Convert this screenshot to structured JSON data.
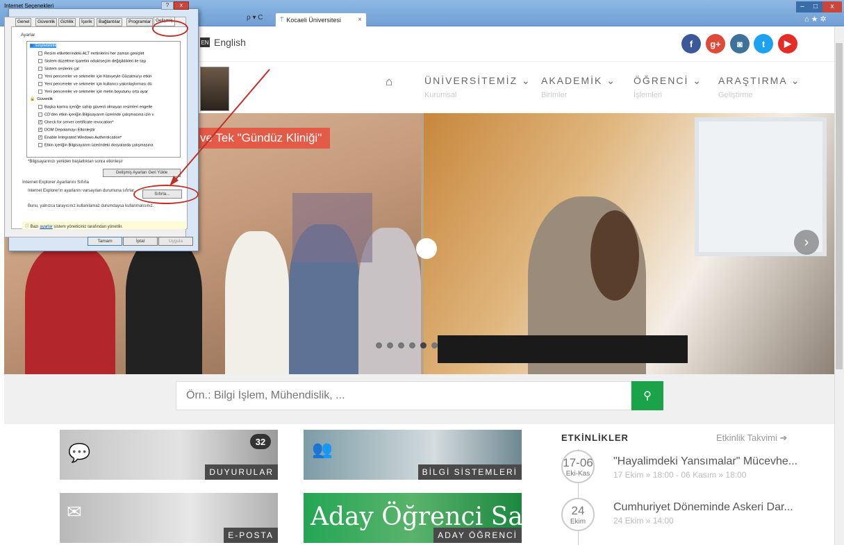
{
  "browser": {
    "tab_title": "Kocaeli Üniversitesi",
    "tab_icon": "kou-favicon-icon",
    "addr_controls": "ρ ▾ C",
    "icons": [
      "home-icon",
      "star-icon",
      "gear-icon"
    ],
    "window_buttons": {
      "min": "–",
      "max": "□",
      "close": "x"
    }
  },
  "site": {
    "language": "English",
    "social": [
      {
        "name": "facebook-icon",
        "glyph": "f",
        "color": "#3b5998"
      },
      {
        "name": "google-plus-icon",
        "glyph": "g+",
        "color": "#dd4b39"
      },
      {
        "name": "instagram-icon",
        "glyph": "◙",
        "color": "#3f729b"
      },
      {
        "name": "twitter-icon",
        "glyph": "t",
        "color": "#1da1f2"
      },
      {
        "name": "youtube-icon",
        "glyph": "▶",
        "color": "#e52d27"
      }
    ],
    "nav": [
      {
        "title": "ÜNİVERSİTEMİZ ⌄",
        "sub": "Kurumsal"
      },
      {
        "title": "AKADEMİK ⌄",
        "sub": "Birimler"
      },
      {
        "title": "ÖĞRENCİ ⌄",
        "sub": "İşlemleri"
      },
      {
        "title": "ARAŞTIRMA ⌄",
        "sub": "Geliştirme"
      }
    ],
    "hero": {
      "banner": "ve Tek \"Gündüz Kliniği\"",
      "slide_count": 6,
      "active_slide": 5
    },
    "search": {
      "placeholder": "Örn.: Bilgi İşlem, Mühendislik, ..."
    },
    "tiles": {
      "duyurular": "DUYURULAR",
      "duyurular_count": "32",
      "bilgi": "BİLGİ SİSTEMLERİ",
      "eposta": "E-POSTA",
      "aday": "ADAY ÖĞRENCİ",
      "aday_art": "Aday Öğrenci Sayfası"
    },
    "events": {
      "title": "ETKİNLİKLER",
      "link": "Etkinlik Takvimi ➔",
      "items": [
        {
          "day": "17-06",
          "month": "Eki-Kas",
          "name": "\"Hayalimdeki Yansımalar\" Mücevhe...",
          "time": "17 Ekim » 18:00 - 06 Kasım » 18:00"
        },
        {
          "day": "24",
          "month": "Ekim",
          "name": "Cumhuriyet Döneminde Askeri Dar...",
          "time": "24 Ekim » 14:00"
        }
      ]
    }
  },
  "dialog": {
    "title": "Internet Seçenekleri",
    "help": "?",
    "close": "x",
    "tabs": [
      "Genel",
      "Güvenlik",
      "Gizlilik",
      "İçerik",
      "Bağlantılar",
      "Programlar",
      "Gelişmiş"
    ],
    "active_tab": "Gelişmiş",
    "settings_label": "Ayarlar",
    "list": [
      {
        "text": "Erişilebilirlik",
        "type": "group"
      },
      {
        "text": "Resim etiketlerindeki ALT metinlerini her zaman genişlet",
        "checked": false
      },
      {
        "text": "Sistem düzeltme işaretini odak/seçim değişiklikleri ile taşı",
        "checked": false
      },
      {
        "text": "Sistem seslerini çal",
        "checked": false
      },
      {
        "text": "Yeni pencereler ve sekmeler için Klavyeyle Gözatma'yı etkin",
        "checked": false
      },
      {
        "text": "Yeni pencereler ve sekmeler için kullanıcı yakınlaştırması dü",
        "checked": false
      },
      {
        "text": "Yeni pencereler ve sekmeler için metin boyutunu orta ayar",
        "checked": false
      },
      {
        "text": "Güvenlik",
        "type": "group"
      },
      {
        "text": "Başka karma içeriğe sahip güvenli olmayan resimleri engelle",
        "checked": false
      },
      {
        "text": "CD'den etkin içeriğin Bilgisayarım üzerinde çalışmasına izin v",
        "checked": false
      },
      {
        "text": "Check for server certificate revocation*",
        "checked": true
      },
      {
        "text": "DOM Depolamayı Etkinleştir",
        "checked": true
      },
      {
        "text": "Enable Integrated Windows Authentication*",
        "checked": true
      },
      {
        "text": "Etkin içeriğin Bilgisayarım üzerindeki dosyalarda çalışmasına",
        "checked": false
      }
    ],
    "restart_note": "*Bilgisayarınızı yeniden başlattıktan sonra etkinleşir",
    "restore_btn": "Gelişmiş Ayarları Geri Yükle",
    "reset_title": "Internet Explorer Ayarlarını Sıfırla",
    "reset_desc": "Internet Explorer'ın ayarlarını varsayılan durumuna sıfırlar.",
    "reset_btn": "Sıfırla...",
    "reset_note": "Bunu, yalnızca tarayıcınız kullanılamaz durumdaysa kullanmalısınız.",
    "info_pre": "Bazı",
    "info_link": "ayarlar",
    "info_post": "sistem yöneticiniz tarafından yönetilir.",
    "ok": "Tamam",
    "cancel": "İptal",
    "apply": "Uygula"
  },
  "annotation": {
    "color": "#c0302a"
  }
}
